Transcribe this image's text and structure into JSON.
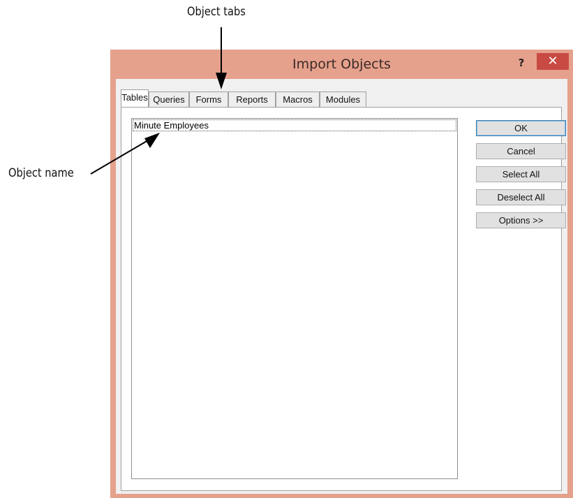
{
  "callouts": {
    "object_tabs": "Object tabs",
    "object_name": "Object name"
  },
  "dialog": {
    "title": "Import Objects",
    "help_label": "?",
    "close_label": "✕",
    "tabs": [
      "Tables",
      "Queries",
      "Forms",
      "Reports",
      "Macros",
      "Modules"
    ],
    "active_tab": "Tables",
    "list_items": [
      "Minute Employees"
    ],
    "buttons": {
      "ok": "OK",
      "cancel": "Cancel",
      "select_all": "Select All",
      "deselect_all": "Deselect All",
      "options": "Options >>"
    }
  },
  "colors": {
    "window_frame": "#e6a18d",
    "close_button": "#c74a43",
    "client_background": "#f0f0f0"
  }
}
